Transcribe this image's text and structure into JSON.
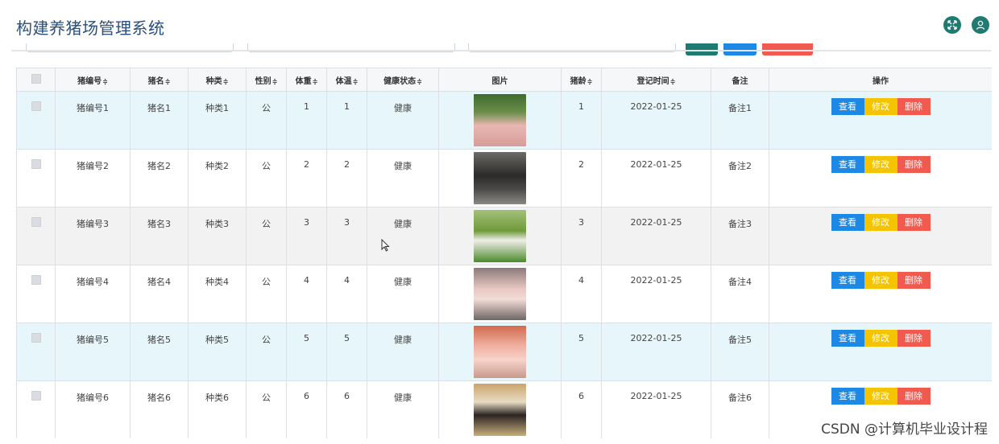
{
  "app": {
    "title": "构建养猪场管理系统"
  },
  "toolbar": {
    "icons": [
      "expand-icon",
      "user-icon"
    ]
  },
  "table": {
    "headers": {
      "pig_no": "猪编号",
      "pig_name": "猪名",
      "breed": "种类",
      "gender": "性别",
      "weight": "体重",
      "temp": "体温",
      "health": "健康状态",
      "image": "图片",
      "age": "猪龄",
      "reg_time": "登记时间",
      "note": "备注",
      "ops": "操作"
    },
    "sort_glyph": "≑",
    "rows": [
      {
        "pig_no": "猪编号1",
        "pig_name": "猪名1",
        "breed": "种类1",
        "gender": "公",
        "weight": "1",
        "temp": "1",
        "health": "健康",
        "age": "1",
        "reg_time": "2022-01-25",
        "note": "备注1"
      },
      {
        "pig_no": "猪编号2",
        "pig_name": "猪名2",
        "breed": "种类2",
        "gender": "公",
        "weight": "2",
        "temp": "2",
        "health": "健康",
        "age": "2",
        "reg_time": "2022-01-25",
        "note": "备注2"
      },
      {
        "pig_no": "猪编号3",
        "pig_name": "猪名3",
        "breed": "种类3",
        "gender": "公",
        "weight": "3",
        "temp": "3",
        "health": "健康",
        "age": "3",
        "reg_time": "2022-01-25",
        "note": "备注3"
      },
      {
        "pig_no": "猪编号4",
        "pig_name": "猪名4",
        "breed": "种类4",
        "gender": "公",
        "weight": "4",
        "temp": "4",
        "health": "健康",
        "age": "4",
        "reg_time": "2022-01-25",
        "note": "备注4"
      },
      {
        "pig_no": "猪编号5",
        "pig_name": "猪名5",
        "breed": "种类5",
        "gender": "公",
        "weight": "5",
        "temp": "5",
        "health": "健康",
        "age": "5",
        "reg_time": "2022-01-25",
        "note": "备注5"
      },
      {
        "pig_no": "猪编号6",
        "pig_name": "猪名6",
        "breed": "种类6",
        "gender": "公",
        "weight": "6",
        "temp": "6",
        "health": "健康",
        "age": "6",
        "reg_time": "2022-01-25",
        "note": "备注6"
      }
    ],
    "actions": {
      "view": "查看",
      "edit": "修改",
      "delete": "删除"
    }
  },
  "watermark": "CSDN @计算机毕业设计程",
  "colors": {
    "title": "#2b4f7c",
    "icon_bg": "#1f7a72",
    "view": "#1e88e5",
    "edit": "#f5c400",
    "delete": "#f05a4f",
    "row_highlight": "#e6f6fa"
  }
}
